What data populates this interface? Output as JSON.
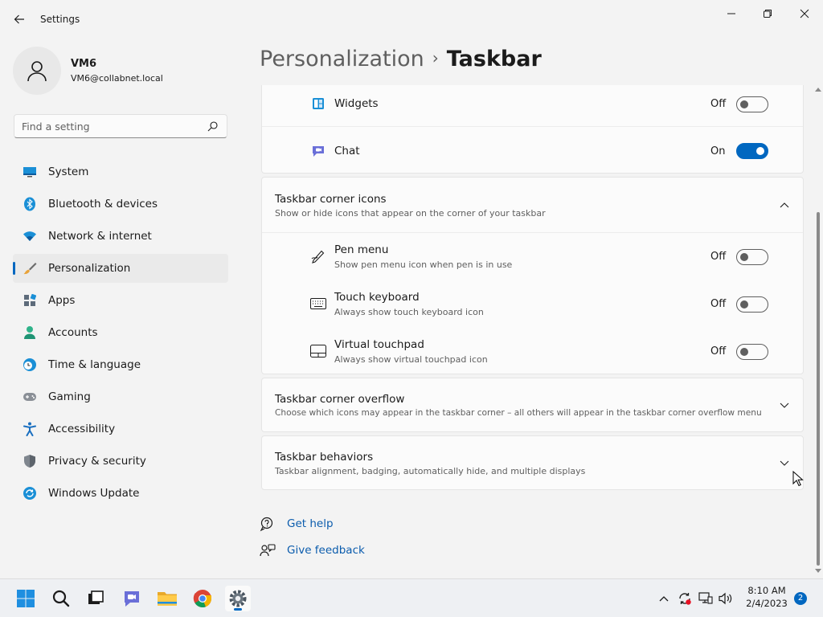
{
  "window": {
    "title": "Settings"
  },
  "profile": {
    "name": "VM6",
    "email": "VM6@collabnet.local"
  },
  "search": {
    "placeholder": "Find a setting"
  },
  "nav": {
    "items": [
      {
        "label": "System",
        "icon": "system-icon"
      },
      {
        "label": "Bluetooth & devices",
        "icon": "bluetooth-icon"
      },
      {
        "label": "Network & internet",
        "icon": "wifi-icon"
      },
      {
        "label": "Personalization",
        "icon": "brush-icon",
        "selected": true
      },
      {
        "label": "Apps",
        "icon": "apps-icon"
      },
      {
        "label": "Accounts",
        "icon": "account-icon"
      },
      {
        "label": "Time & language",
        "icon": "clock-globe-icon"
      },
      {
        "label": "Gaming",
        "icon": "gamepad-icon"
      },
      {
        "label": "Accessibility",
        "icon": "accessibility-icon"
      },
      {
        "label": "Privacy & security",
        "icon": "shield-icon"
      },
      {
        "label": "Windows Update",
        "icon": "update-icon"
      }
    ]
  },
  "breadcrumb": {
    "parent": "Personalization",
    "separator": "›",
    "current": "Taskbar"
  },
  "taskbar_items": {
    "widgets": {
      "label": "Widgets",
      "state": "Off",
      "on": false,
      "icon": "widgets-icon"
    },
    "chat": {
      "label": "Chat",
      "state": "On",
      "on": true,
      "icon": "chat-icon"
    }
  },
  "corner_icons": {
    "title": "Taskbar corner icons",
    "subtitle": "Show or hide icons that appear on the corner of your taskbar",
    "expanded": true,
    "items": {
      "pen": {
        "label": "Pen menu",
        "sub": "Show pen menu icon when pen is in use",
        "state": "Off",
        "on": false,
        "icon": "pen-icon"
      },
      "keyboard": {
        "label": "Touch keyboard",
        "sub": "Always show touch keyboard icon",
        "state": "Off",
        "on": false,
        "icon": "keyboard-icon"
      },
      "touchpad": {
        "label": "Virtual touchpad",
        "sub": "Always show virtual touchpad icon",
        "state": "Off",
        "on": false,
        "icon": "touchpad-icon"
      }
    }
  },
  "corner_overflow": {
    "title": "Taskbar corner overflow",
    "subtitle": "Choose which icons may appear in the taskbar corner – all others will appear in the taskbar corner overflow menu"
  },
  "behaviors": {
    "title": "Taskbar behaviors",
    "subtitle": "Taskbar alignment, badging, automatically hide, and multiple displays"
  },
  "help": {
    "get_help": "Get help",
    "give_feedback": "Give feedback"
  },
  "os_taskbar": {
    "apps": [
      "start-icon",
      "search-icon",
      "task-view-icon",
      "teams-chat-icon",
      "file-explorer-icon",
      "chrome-icon",
      "settings-icon"
    ],
    "active_app": "settings-icon",
    "clock": {
      "time": "8:10 AM",
      "date": "2/4/2023"
    },
    "notification_count": "2"
  },
  "colors": {
    "accent": "#0067c0",
    "link": "#0b5cad",
    "background": "#f3f3f3",
    "card": "#fbfbfb"
  }
}
